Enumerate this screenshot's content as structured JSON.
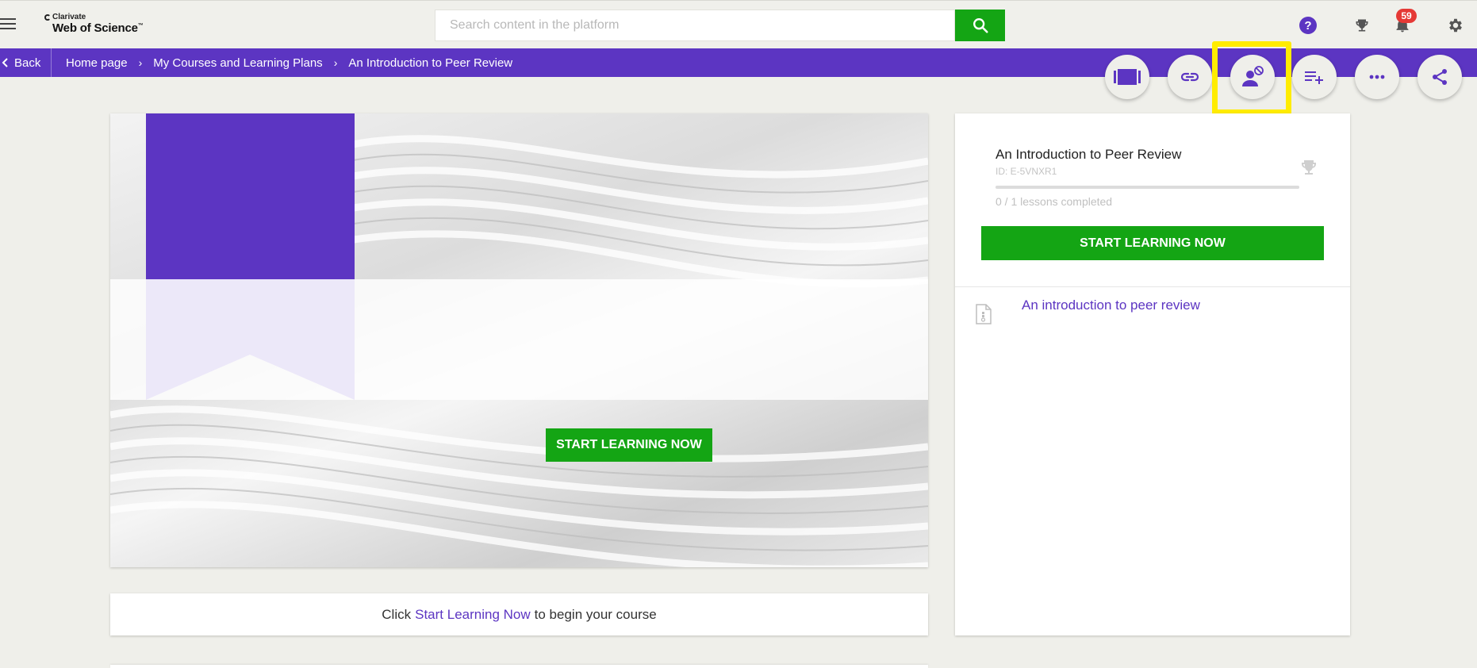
{
  "app": {
    "logo_small": "Clarivate",
    "logo_big": "Web of Science",
    "logo_tm": "™"
  },
  "search": {
    "placeholder": "Search content in the platform",
    "value": ""
  },
  "notifications": {
    "count": "59"
  },
  "nav": {
    "back_label": "Back",
    "breadcrumbs": [
      "Home page",
      "My Courses and Learning Plans",
      "An Introduction to Peer Review"
    ],
    "separator": "›"
  },
  "actions": [
    "slideshow-icon",
    "link-icon",
    "unenroll-user-icon",
    "add-to-playlist-icon",
    "more-icon",
    "share-icon"
  ],
  "hero": {
    "cta_label": "START LEARNING NOW"
  },
  "caption": {
    "prefix": "Click",
    "link": "Start Learning Now",
    "suffix": "to begin your course"
  },
  "course": {
    "title": "An Introduction to Peer Review",
    "id": "ID: E-5VNXR1",
    "progress_fraction": 0,
    "progress_text": "0 / 1 lessons completed",
    "cta_label": "START LEARNING NOW",
    "lessons": [
      {
        "title": "An introduction to peer review"
      }
    ]
  },
  "colors": {
    "brand_purple": "#5c35c2",
    "cta_green": "#14a514",
    "highlight_yellow": "#ffec00",
    "badge_red": "#e53935"
  }
}
